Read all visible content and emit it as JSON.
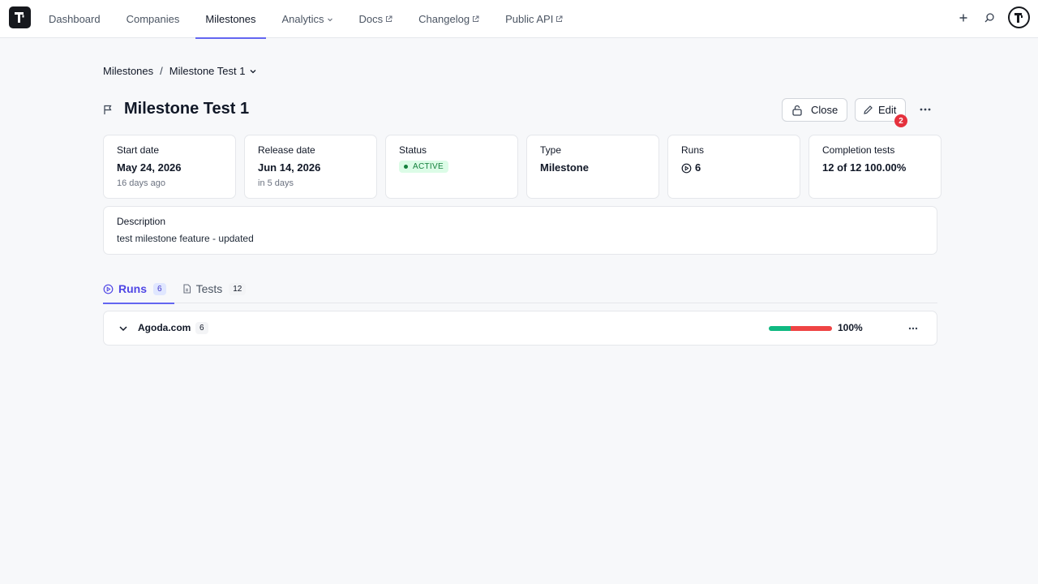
{
  "nav": {
    "items": [
      {
        "label": "Dashboard"
      },
      {
        "label": "Companies"
      },
      {
        "label": "Milestones"
      },
      {
        "label": "Analytics"
      },
      {
        "label": "Docs"
      },
      {
        "label": "Changelog"
      },
      {
        "label": "Public API"
      }
    ],
    "active": "Milestones"
  },
  "breadcrumb": {
    "root": "Milestones",
    "separator": "/",
    "current": "Milestone Test 1"
  },
  "header": {
    "title": "Milestone Test 1",
    "close_label": "Close",
    "edit_label": "Edit",
    "edit_badge": "2"
  },
  "cards": {
    "start": {
      "label": "Start date",
      "value": "May 24, 2026",
      "sub": "16 days ago"
    },
    "release": {
      "label": "Release date",
      "value": "Jun 14, 2026",
      "sub": "in 5 days"
    },
    "status": {
      "label": "Status",
      "value": "ACTIVE"
    },
    "type": {
      "label": "Type",
      "value": "Milestone"
    },
    "runs": {
      "label": "Runs",
      "value": "6"
    },
    "completion": {
      "label": "Completion tests",
      "value": "12 of 12 100.00%"
    }
  },
  "description": {
    "label": "Description",
    "text": "test milestone feature - updated"
  },
  "tabs": [
    {
      "label": "Runs",
      "count": "6",
      "active": true
    },
    {
      "label": "Tests",
      "count": "12",
      "active": false
    }
  ],
  "groups": [
    {
      "name": "Agoda.com",
      "count": "6",
      "percent": "100%",
      "passed_fraction": 0.35,
      "failed_fraction": 0.65
    }
  ],
  "colors": {
    "accent": "#6366f1",
    "pass": "#10b981",
    "fail": "#ef4444",
    "status_bg": "#dcfce7",
    "status_fg": "#15803d",
    "badge": "#e5313d"
  },
  "icons": [
    "app-logo-icon",
    "external-link-icon",
    "chevron-down-icon",
    "plus-icon",
    "search-icon",
    "avatar-icon",
    "flag-icon",
    "lock-icon",
    "pencil-icon",
    "more-icon",
    "play-circle-icon",
    "file-icon"
  ]
}
